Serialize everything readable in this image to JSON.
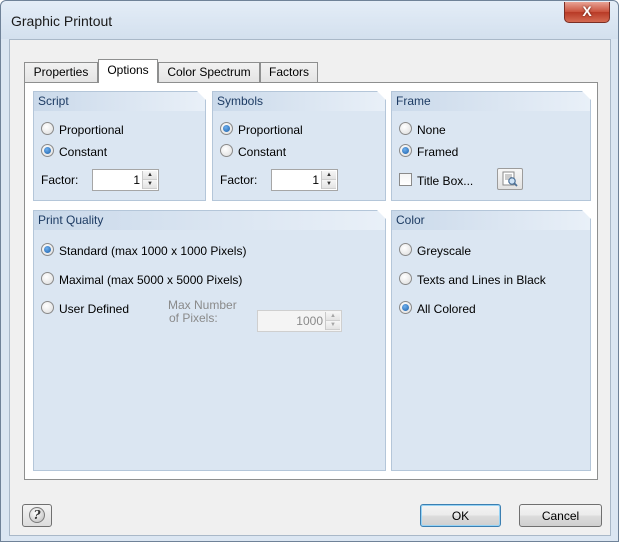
{
  "window": {
    "title": "Graphic Printout",
    "close_glyph": "X"
  },
  "tabs": [
    {
      "label": "Properties"
    },
    {
      "label": "Options",
      "active": true
    },
    {
      "label": "Color Spectrum"
    },
    {
      "label": "Factors"
    }
  ],
  "script": {
    "header": "Script",
    "options": [
      "Proportional",
      "Constant"
    ],
    "selected": "Constant",
    "factor_label": "Factor:",
    "factor_value": "1"
  },
  "symbols": {
    "header": "Symbols",
    "options": [
      "Proportional",
      "Constant"
    ],
    "selected": "Proportional",
    "factor_label": "Factor:",
    "factor_value": "1"
  },
  "frame": {
    "header": "Frame",
    "options": [
      "None",
      "Framed"
    ],
    "selected": "Framed",
    "title_box_label": "Title Box...",
    "title_box_checked": false,
    "title_box_button_icon": "preview-icon"
  },
  "print_quality": {
    "header": "Print Quality",
    "options": [
      "Standard (max 1000 x 1000 Pixels)",
      "Maximal (max 5000 x 5000 Pixels)",
      "User Defined"
    ],
    "selected": "Standard (max 1000 x 1000 Pixels)",
    "max_pixels_label_line1": "Max Number",
    "max_pixels_label_line2": "of Pixels:",
    "max_pixels_value": "1000"
  },
  "color": {
    "header": "Color",
    "options": [
      "Greyscale",
      "Texts and Lines in Black",
      "All Colored"
    ],
    "selected": "All Colored"
  },
  "footer": {
    "help_icon": "help-icon",
    "ok_label": "OK",
    "cancel_label": "Cancel"
  },
  "colors": {
    "group_background": "#dbe6f2",
    "header_text": "#1d3b63",
    "close_button": "#c9513c"
  }
}
